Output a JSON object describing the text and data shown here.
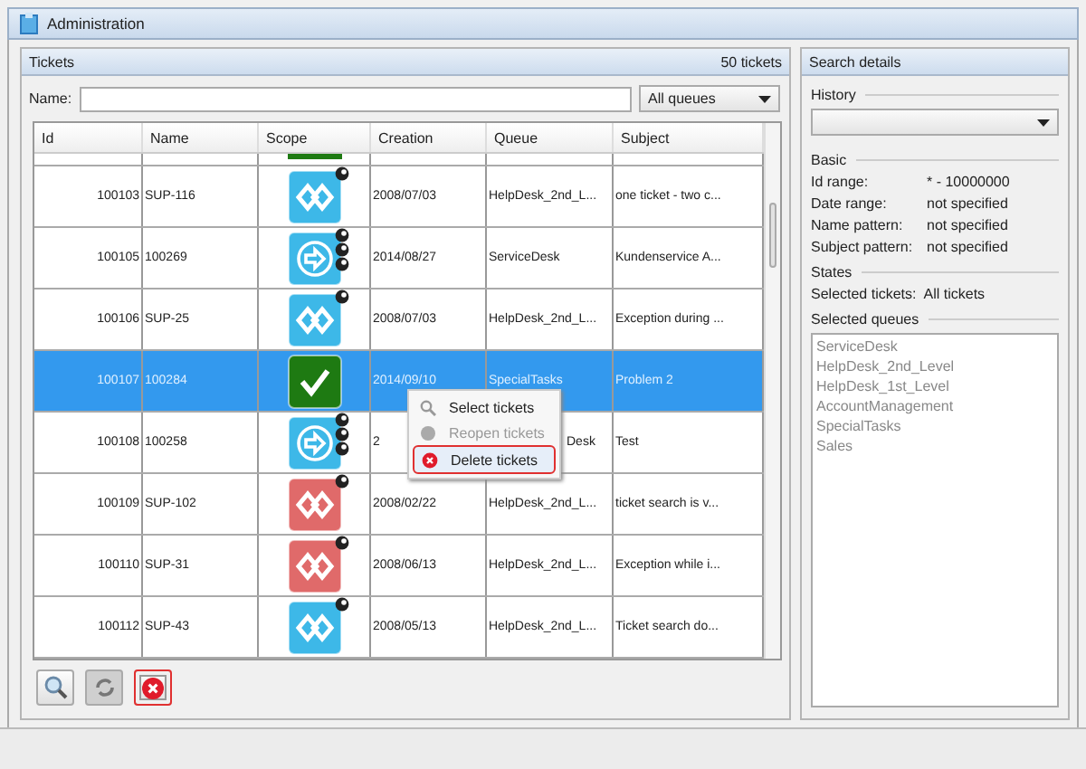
{
  "window": {
    "title": "Administration"
  },
  "tickets": {
    "title": "Tickets",
    "count": "50 tickets",
    "name_label": "Name:",
    "queue_filter": "All queues",
    "columns": [
      "Id",
      "Name",
      "Scope",
      "Creation",
      "Queue",
      "Subject"
    ],
    "rows": [
      {
        "id": "100103",
        "name": "SUP-116",
        "scope": {
          "kind": "link",
          "color": "#3db8e8"
        },
        "creation": "2008/07/03",
        "queue": "HelpDesk_2nd_L...",
        "subject": "one ticket - two c...",
        "selected": false
      },
      {
        "id": "100105",
        "name": "100269",
        "scope": {
          "kind": "arrow",
          "color": "#3db8e8"
        },
        "creation": "2014/08/27",
        "queue": "ServiceDesk",
        "subject": "Kundenservice A...",
        "selected": false
      },
      {
        "id": "100106",
        "name": "SUP-25",
        "scope": {
          "kind": "link",
          "color": "#3db8e8"
        },
        "creation": "2008/07/03",
        "queue": "HelpDesk_2nd_L...",
        "subject": "Exception during ...",
        "selected": false
      },
      {
        "id": "100107",
        "name": "100284",
        "scope": {
          "kind": "check",
          "color": "#1e7a12"
        },
        "creation": "2014/09/10",
        "queue": "SpecialTasks",
        "subject": "Problem 2",
        "selected": true
      },
      {
        "id": "100108",
        "name": "100258",
        "scope": {
          "kind": "arrow",
          "color": "#3db8e8"
        },
        "creation": "2",
        "queue": "Desk",
        "subject": "Test",
        "selected": false,
        "under_menu": true
      },
      {
        "id": "100109",
        "name": "SUP-102",
        "scope": {
          "kind": "link",
          "color": "#e06a6a"
        },
        "creation": "2008/02/22",
        "queue": "HelpDesk_2nd_L...",
        "subject": "ticket search is v...",
        "selected": false
      },
      {
        "id": "100110",
        "name": "SUP-31",
        "scope": {
          "kind": "link",
          "color": "#e06a6a"
        },
        "creation": "2008/06/13",
        "queue": "HelpDesk_2nd_L...",
        "subject": "Exception while i...",
        "selected": false
      },
      {
        "id": "100112",
        "name": "SUP-43",
        "scope": {
          "kind": "link",
          "color": "#3db8e8"
        },
        "creation": "2008/05/13",
        "queue": "HelpDesk_2nd_L...",
        "subject": "Ticket search do...",
        "selected": false
      }
    ],
    "context_menu": [
      {
        "label": "Select tickets",
        "kind": "search",
        "disabled": false,
        "highlighted": false
      },
      {
        "label": "Reopen tickets",
        "kind": "reopen",
        "disabled": true,
        "highlighted": false
      },
      {
        "label": "Delete tickets",
        "kind": "delete",
        "disabled": false,
        "highlighted": true
      }
    ],
    "toolbar": [
      {
        "kind": "search",
        "disabled": false,
        "highlighted": false
      },
      {
        "kind": "refresh",
        "disabled": true,
        "highlighted": false
      },
      {
        "kind": "delete",
        "disabled": false,
        "highlighted": true
      }
    ]
  },
  "search_details": {
    "title": "Search details",
    "history_label": "History",
    "basic_label": "Basic",
    "basic": [
      {
        "key": "Id range:",
        "value": "* - 10000000"
      },
      {
        "key": "Date range:",
        "value": "not specified"
      },
      {
        "key": "Name pattern:",
        "value": "not specified"
      },
      {
        "key": "Subject pattern:",
        "value": "not specified"
      }
    ],
    "states_label": "States",
    "states": [
      {
        "key": "Selected tickets:",
        "value": "All tickets"
      }
    ],
    "queues_label": "Selected queues",
    "queues_disabled": true,
    "queues": [
      "ServiceDesk",
      "HelpDesk_2nd_Level",
      "HelpDesk_1st_Level",
      "AccountManagement",
      "SpecialTasks",
      "Sales"
    ]
  }
}
